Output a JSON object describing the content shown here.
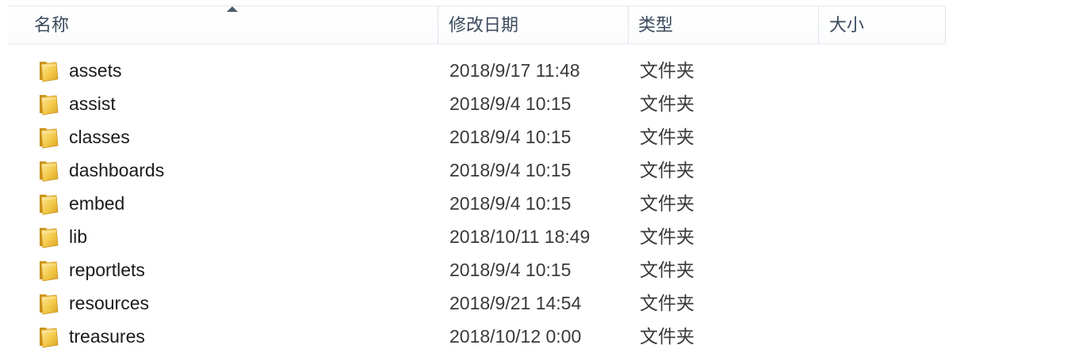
{
  "columns": {
    "name": "名称",
    "date": "修改日期",
    "type": "类型",
    "size": "大小"
  },
  "sort": {
    "column": "name",
    "direction": "ascending",
    "icon": "sort-up-arrow-icon"
  },
  "folder_icon": "folder-icon",
  "folder_color": "#e8b92e",
  "files": [
    {
      "name": "assets",
      "date": "2018/9/17 11:48",
      "type": "文件夹",
      "size": ""
    },
    {
      "name": "assist",
      "date": "2018/9/4 10:15",
      "type": "文件夹",
      "size": ""
    },
    {
      "name": "classes",
      "date": "2018/9/4 10:15",
      "type": "文件夹",
      "size": ""
    },
    {
      "name": "dashboards",
      "date": "2018/9/4 10:15",
      "type": "文件夹",
      "size": ""
    },
    {
      "name": "embed",
      "date": "2018/9/4 10:15",
      "type": "文件夹",
      "size": ""
    },
    {
      "name": "lib",
      "date": "2018/10/11 18:49",
      "type": "文件夹",
      "size": ""
    },
    {
      "name": "reportlets",
      "date": "2018/9/4 10:15",
      "type": "文件夹",
      "size": ""
    },
    {
      "name": "resources",
      "date": "2018/9/21 14:54",
      "type": "文件夹",
      "size": ""
    },
    {
      "name": "treasures",
      "date": "2018/10/12 0:00",
      "type": "文件夹",
      "size": ""
    }
  ]
}
